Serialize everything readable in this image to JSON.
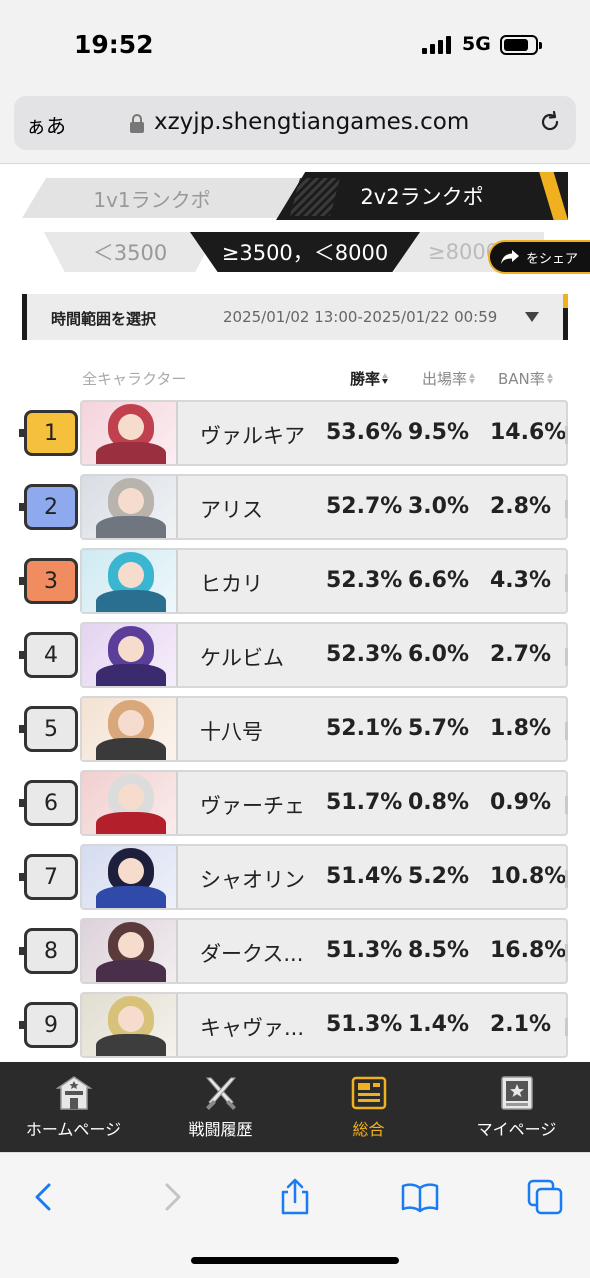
{
  "status": {
    "time": "19:52",
    "network": "5G"
  },
  "browser": {
    "aa_label": "ぁあ",
    "url": "xzyjp.shengtiangames.com"
  },
  "mode_tabs": [
    {
      "label": "1v1ランクポ",
      "active": false
    },
    {
      "label": "2v2ランクポ",
      "active": true
    }
  ],
  "score_tabs": [
    {
      "label": "＜3500",
      "active": false
    },
    {
      "label": "≥3500，＜8000",
      "active": true
    },
    {
      "label": "≥8000",
      "active": false
    }
  ],
  "share": {
    "label": "をシェア"
  },
  "time_range": {
    "label": "時間範囲を選択",
    "value": "2025/01/02 13:00-2025/01/22 00:59"
  },
  "table": {
    "headers": {
      "name": "全キャラクター",
      "win": "勝率",
      "pick": "出場率",
      "ban": "BAN率"
    },
    "rows": [
      {
        "rank": "1",
        "name": "ヴァルキア",
        "win": "53.6%",
        "pick": "9.5%",
        "ban": "14.6%"
      },
      {
        "rank": "2",
        "name": "アリス",
        "win": "52.7%",
        "pick": "3.0%",
        "ban": "2.8%"
      },
      {
        "rank": "3",
        "name": "ヒカリ",
        "win": "52.3%",
        "pick": "6.6%",
        "ban": "4.3%"
      },
      {
        "rank": "4",
        "name": "ケルビム",
        "win": "52.3%",
        "pick": "6.0%",
        "ban": "2.7%"
      },
      {
        "rank": "5",
        "name": "十八号",
        "win": "52.1%",
        "pick": "5.7%",
        "ban": "1.8%"
      },
      {
        "rank": "6",
        "name": "ヴァーチェ",
        "win": "51.7%",
        "pick": "0.8%",
        "ban": "0.9%"
      },
      {
        "rank": "7",
        "name": "シャオリン",
        "win": "51.4%",
        "pick": "5.2%",
        "ban": "10.8%"
      },
      {
        "rank": "8",
        "name": "ダークス...",
        "win": "51.3%",
        "pick": "8.5%",
        "ban": "16.8%"
      },
      {
        "rank": "9",
        "name": "キャヴァ...",
        "win": "51.3%",
        "pick": "1.4%",
        "ban": "2.1%"
      }
    ]
  },
  "bottom_nav": [
    {
      "label": "ホームページ",
      "icon": "home-icon",
      "active": false
    },
    {
      "label": "戦闘履歴",
      "icon": "crossed-swords-icon",
      "active": false
    },
    {
      "label": "総合",
      "icon": "stats-board-icon",
      "active": true
    },
    {
      "label": "マイページ",
      "icon": "profile-card-icon",
      "active": false
    }
  ],
  "colors": {
    "accent": "#f0b020",
    "rank1": "#f5c03c",
    "rank2": "#8fa9ee",
    "rank3": "#f18b60",
    "dark": "#1b1b1b",
    "ios_blue": "#1a7cf5"
  }
}
